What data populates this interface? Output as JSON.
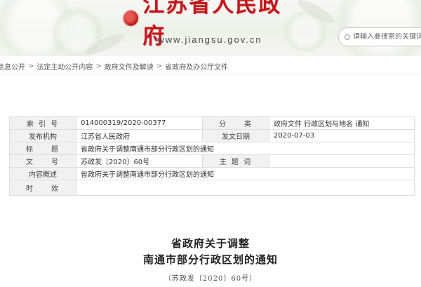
{
  "header": {
    "site_name": "江苏省人民政府",
    "site_url": "www.jiangsu.gov.cn",
    "search_placeholder": "请输入要搜索的关键词"
  },
  "breadcrumb": {
    "items": [
      "信息公开",
      "法定主动公开内容",
      "政府文件及解读",
      "省政府及办公厅文件"
    ],
    "separator": ">"
  },
  "info_table": {
    "rows": [
      {
        "label1": "索 引 号",
        "value1": "014000319/2020-00377",
        "label2": "分　　类",
        "value2": "政府文件 行政区划与地名 通知"
      },
      {
        "label1": "发布机构",
        "value1": "江苏省人民政府",
        "label2": "发文日期",
        "value2": "2020-07-03"
      },
      {
        "label1": "标　　题",
        "value1": "省政府关于调整南通市部分行政区划的通知"
      },
      {
        "label1": "文　　号",
        "value1": "苏政发〔2020〕60号",
        "label2": "主 题 词",
        "value2": ""
      },
      {
        "label1": "内容概述",
        "value1": "省政府关于调整南通市部分行政区划的通知"
      },
      {
        "label1": "时　　效",
        "value1": ""
      }
    ]
  },
  "document": {
    "title_line1": "省政府关于调整",
    "title_line2": "南通市部分行政区划的通知",
    "doc_number": "（苏政发〔2020〕60号）"
  },
  "colors": {
    "logo_red": "#c0171c",
    "label_bg": "#f1f1f1",
    "border": "#dddddd"
  }
}
